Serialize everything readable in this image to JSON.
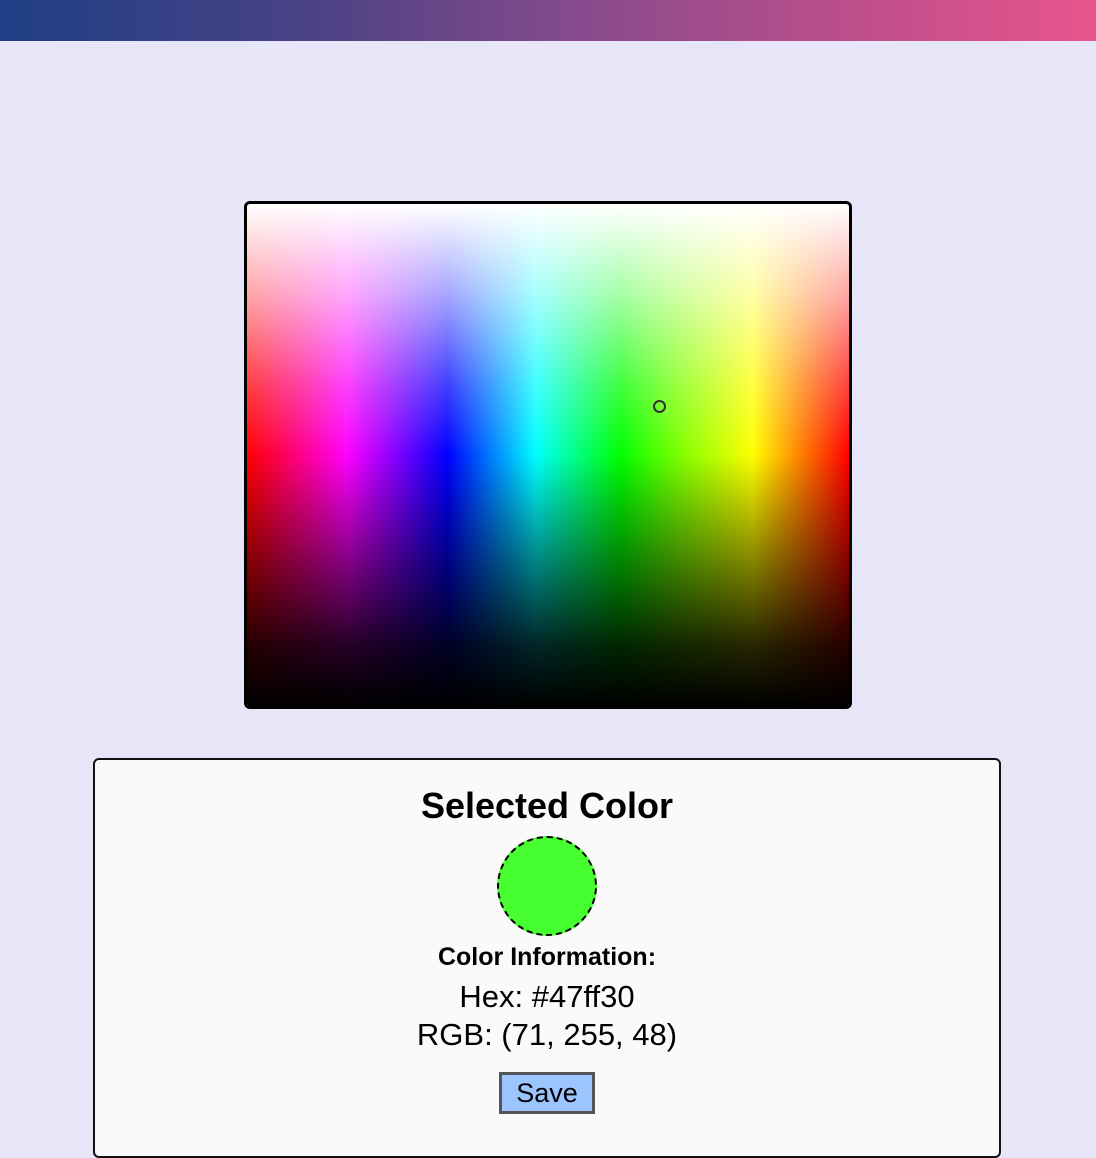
{
  "colors": {
    "selected_hex": "#47ff30"
  },
  "panel": {
    "title": "Selected Color",
    "info_title": "Color Information:",
    "hex_line": "Hex: #47ff30",
    "rgb_line": "RGB: (71, 255, 48)",
    "save_label": "Save"
  }
}
